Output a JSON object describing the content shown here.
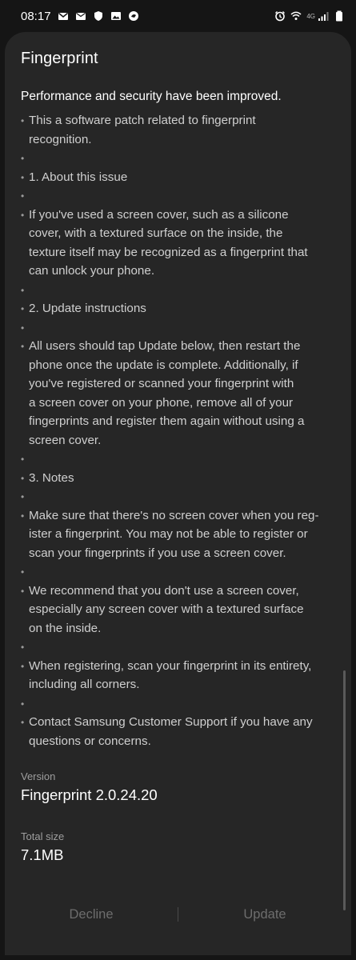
{
  "status_bar": {
    "time": "08:17",
    "left_icons": [
      "gmail-icon",
      "mail-icon",
      "shield-icon",
      "image-icon",
      "app-icon"
    ],
    "network": "4G",
    "right_icons": [
      "alarm-icon",
      "wifi-icon",
      "signal-icon",
      "battery-icon"
    ]
  },
  "dialog": {
    "title": "Fingerprint",
    "headline": "Performance and security have been improved.",
    "notes_lines": [
      {
        "bullet": true,
        "text": "This a software patch related to fingerprint"
      },
      {
        "bullet": false,
        "text": "recognition."
      },
      {
        "bullet": true,
        "text": ""
      },
      {
        "bullet": true,
        "text": "1. About this issue"
      },
      {
        "bullet": true,
        "text": ""
      },
      {
        "bullet": true,
        "text": "If you've used a screen cover, such as a silicone"
      },
      {
        "bullet": false,
        "text": "cover, with a textured surface on the inside, the"
      },
      {
        "bullet": false,
        "text": "texture itself may be recognized as a fingerprint that"
      },
      {
        "bullet": false,
        "text": "can unlock your phone."
      },
      {
        "bullet": true,
        "text": ""
      },
      {
        "bullet": true,
        "text": "2. Update instructions"
      },
      {
        "bullet": true,
        "text": ""
      },
      {
        "bullet": true,
        "text": "All users should tap Update below, then restart the"
      },
      {
        "bullet": false,
        "text": "phone once the update is complete. Additionally, if"
      },
      {
        "bullet": false,
        "text": "you've registered or scanned your fingerprint with"
      },
      {
        "bullet": false,
        "text": "a screen cover on your phone, remove all of your"
      },
      {
        "bullet": false,
        "text": "fingerprints and register them again without using a"
      },
      {
        "bullet": false,
        "text": "screen cover."
      },
      {
        "bullet": true,
        "text": ""
      },
      {
        "bullet": true,
        "text": "3. Notes"
      },
      {
        "bullet": true,
        "text": ""
      },
      {
        "bullet": true,
        "text": "Make sure that there's no screen cover when you reg-"
      },
      {
        "bullet": false,
        "text": "ister a fingerprint. You may not be able to register or"
      },
      {
        "bullet": false,
        "text": "scan your fingerprints if you use a screen cover."
      },
      {
        "bullet": true,
        "text": ""
      },
      {
        "bullet": true,
        "text": "We recommend that you don't use a screen cover,"
      },
      {
        "bullet": false,
        "text": "especially any screen cover with a textured surface"
      },
      {
        "bullet": false,
        "text": "on the inside."
      },
      {
        "bullet": true,
        "text": ""
      },
      {
        "bullet": true,
        "text": "When registering, scan your fingerprint in its entirety,"
      },
      {
        "bullet": false,
        "text": "including all corners."
      },
      {
        "bullet": true,
        "text": ""
      },
      {
        "bullet": true,
        "text": "Contact Samsung Customer Support if you have any"
      },
      {
        "bullet": false,
        "text": "questions or concerns."
      }
    ],
    "version_label": "Version",
    "version_value": "Fingerprint 2.0.24.20",
    "size_label": "Total size",
    "size_value": "7.1MB",
    "buttons": {
      "decline": "Decline",
      "update": "Update"
    }
  },
  "colors": {
    "background": "#151515",
    "dialog": "#262626",
    "text_primary": "#ffffff",
    "text_secondary": "#cfcfcf",
    "button_text": "#6d6d6d"
  }
}
